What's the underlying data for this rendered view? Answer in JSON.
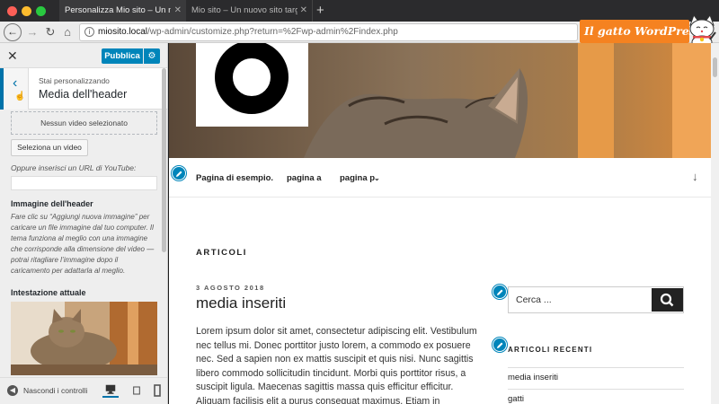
{
  "browser": {
    "tabs": [
      {
        "title": "Personalizza Mio sito – Un nuovo sito",
        "active": true
      },
      {
        "title": "Mio sito – Un nuovo sito targato Wo",
        "active": false
      }
    ],
    "url_host": "miosito.local",
    "url_path": "/wp-admin/customize.php?return=%2Fwp-admin%2Findex.php"
  },
  "overlay": {
    "logo_text": "Il gatto WordPress"
  },
  "customizer": {
    "publish_label": "Pubblica",
    "subtitle": "Stai personalizzando",
    "title": "Media dell'header",
    "no_video": "Nessun video selezionato",
    "select_video": "Seleziona un video",
    "youtube_label": "Oppure inserisci un URL di YouTube:",
    "youtube_value": "",
    "header_image_title": "Immagine dell'header",
    "header_image_desc": "Fare clic su “Aggiungi nuova immagine” per caricare un file immagine dal tuo computer. Il tema funziona al meglio con una immagine che corrisponde alla dimensione del video — potrai ritagliare l’immagine dopo il caricamento per adattarla al meglio.",
    "current_header_title": "Intestazione attuale",
    "hide_controls": "Nascondi i controlli"
  },
  "preview": {
    "nav": [
      "Pagina di esempio.",
      "pagina a",
      "pagina p"
    ],
    "section_title": "ARTICOLI",
    "post_date": "3 AGOSTO 2018",
    "post_title": "media inseriti",
    "post_body": "Lorem ipsum dolor sit amet, consectetur adipiscing elit. Vestibulum nec tellus mi. Donec porttitor justo lorem, a commodo ex posuere nec. Sed a sapien non ex mattis suscipit et quis nisi. Nunc sagittis libero commodo sollicitudin tincidunt. Morbi quis porttitor risus, a suscipit ligula. Maecenas sagittis massa quis efficitur efficitur. Aliquam facilisis elit a purus consequat maximus. Etiam in vulputate",
    "search_placeholder": "Cerca ...",
    "recent_title": "ARTICOLI RECENTI",
    "recent_posts": [
      "media inseriti",
      "gatti"
    ]
  }
}
